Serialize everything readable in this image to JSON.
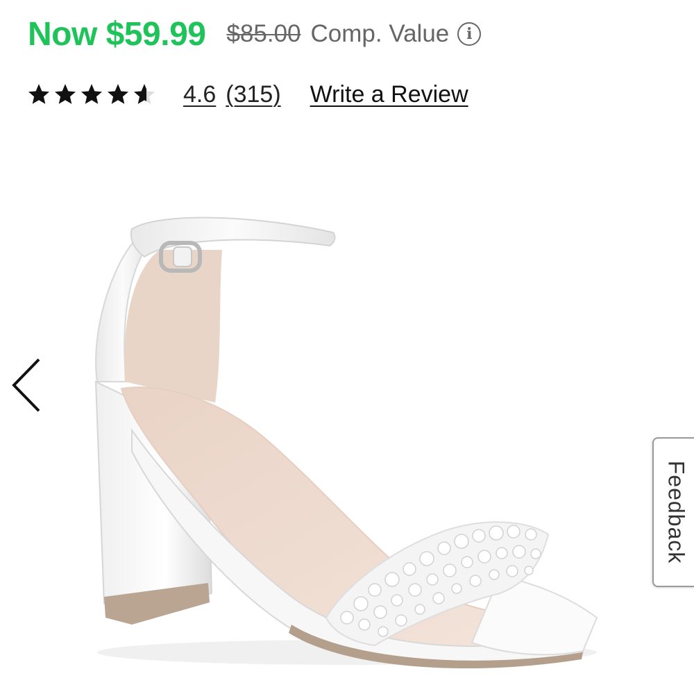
{
  "price": {
    "now": "Now $59.99",
    "was": "$85.00",
    "comp_label": "Comp. Value",
    "now_color": "#1fc35a"
  },
  "rating": {
    "value": "4.6",
    "count": "(315)",
    "stars_filled_fraction": 0.92,
    "write_review": "Write a Review"
  },
  "gallery": {
    "prev_icon": "chevron-left-icon",
    "image_subject": "white satin block-heel sandal with pearl-embellished toe strap and ankle strap"
  },
  "feedback": {
    "label": "Feedback"
  }
}
